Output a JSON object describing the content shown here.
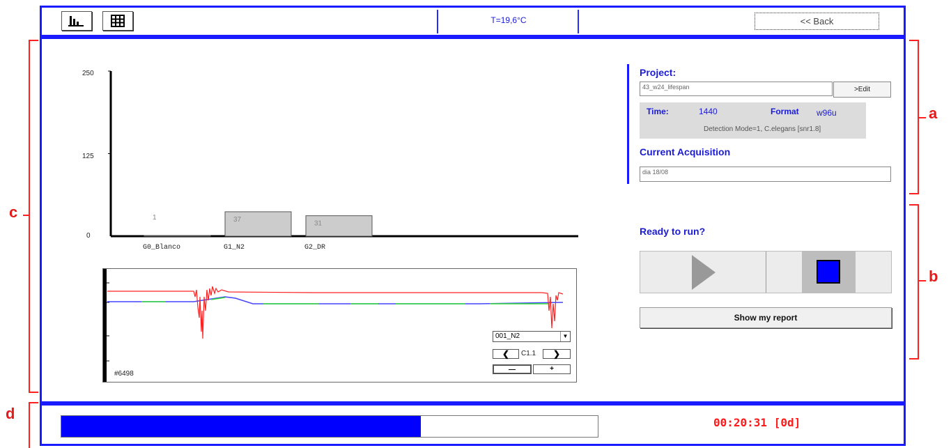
{
  "toolbar": {
    "temperature": "T=19,6°C",
    "back_label": "<< Back"
  },
  "chart_data": {
    "type": "bar",
    "categories": [
      "G0_Blanco",
      "G1_N2",
      "G2_DR"
    ],
    "values": [
      1,
      37,
      31
    ],
    "yticks": [
      "250",
      "125",
      "0"
    ],
    "ylim": [
      0,
      250
    ],
    "colors": {
      "bar": "#cccccc",
      "axis": "#000000"
    }
  },
  "trace": {
    "id_label": "#6498",
    "select_value": "001_N2",
    "channel_label": "C1.1",
    "minus_label": "—",
    "plus_label": "+",
    "colors": {
      "red": "#ff2020",
      "blue": "#4444ff",
      "green": "#33dd33"
    }
  },
  "project": {
    "label": "Project:",
    "name": "43_w24_lifespan",
    "edit_label": ">Edit",
    "time_label": "Time:",
    "time_value": "1440",
    "format_label": "Format",
    "format_value": "w96u",
    "detection": "Detection Mode=1, C.elegans [snr1.8]"
  },
  "acquisition": {
    "label": "Current Acquisition",
    "value": "dia 18/08"
  },
  "run": {
    "ready_label": "Ready to run?",
    "report_label": "Show my report"
  },
  "status": {
    "progress": 0.67,
    "elapsed": "00:20:31 [0d]",
    "progress_color": "#0000ff"
  },
  "annotations": {
    "a": "a",
    "b": "b",
    "c": "c",
    "d": "d"
  }
}
